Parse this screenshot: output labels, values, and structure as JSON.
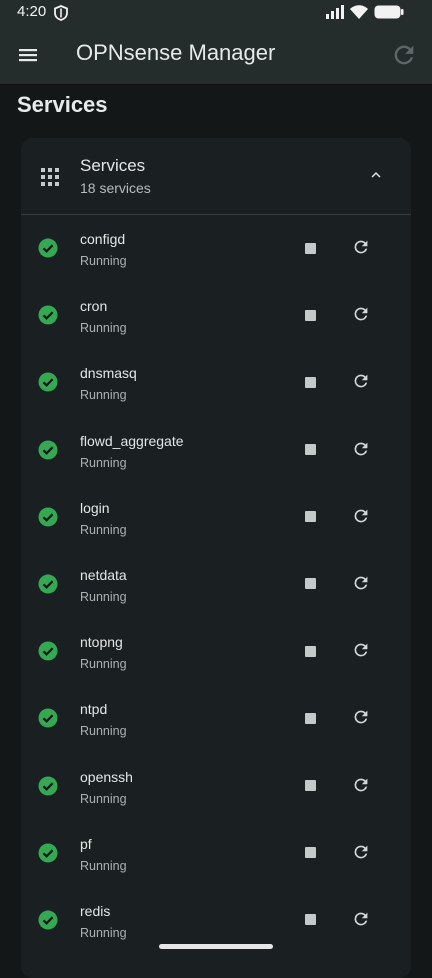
{
  "status_bar": {
    "time": "4:20"
  },
  "app_bar": {
    "title": "OPNsense Manager"
  },
  "page": {
    "title": "Services"
  },
  "card": {
    "title": "Services",
    "subtitle": "18 services"
  },
  "colors": {
    "running": "#34a853",
    "background": "#131718",
    "app_bar": "#242c2c",
    "card": "#1a2021"
  },
  "services": [
    {
      "name": "configd",
      "status": "Running"
    },
    {
      "name": "cron",
      "status": "Running"
    },
    {
      "name": "dnsmasq",
      "status": "Running"
    },
    {
      "name": "flowd_aggregate",
      "status": "Running"
    },
    {
      "name": "login",
      "status": "Running"
    },
    {
      "name": "netdata",
      "status": "Running"
    },
    {
      "name": "ntopng",
      "status": "Running"
    },
    {
      "name": "ntpd",
      "status": "Running"
    },
    {
      "name": "openssh",
      "status": "Running"
    },
    {
      "name": "pf",
      "status": "Running"
    },
    {
      "name": "redis",
      "status": "Running"
    }
  ]
}
